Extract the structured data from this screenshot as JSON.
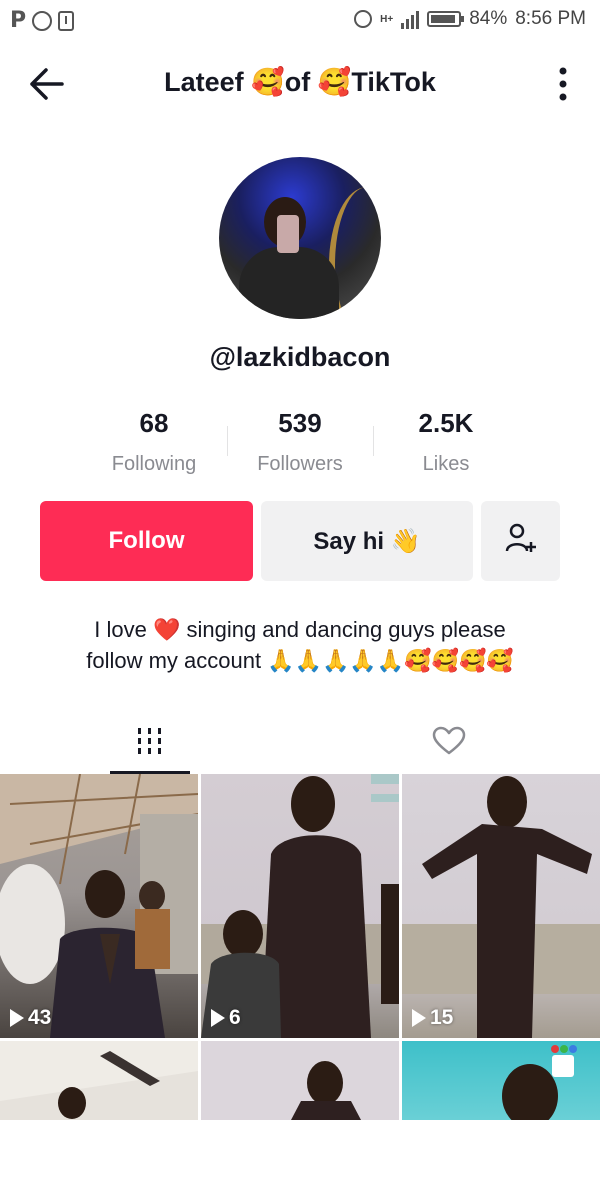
{
  "status_bar": {
    "left_icons": [
      "p-icon",
      "whatsapp-icon",
      "download-icon"
    ],
    "left_p": "P",
    "network": "H+",
    "battery": "84%",
    "time": "8:56 PM"
  },
  "header": {
    "title": "Lateef 🥰of 🥰TikTok",
    "back_icon": "back-arrow-icon",
    "more_icon": "more-vertical-icon"
  },
  "profile": {
    "handle": "@lazkidbacon",
    "stats": [
      {
        "value": "68",
        "label": "Following"
      },
      {
        "value": "539",
        "label": "Followers"
      },
      {
        "value": "2.5K",
        "label": "Likes"
      }
    ],
    "follow_label": "Follow",
    "say_hi_label": "Say hi 👋",
    "bio_line1": "I love ❤️ singing and dancing guys please",
    "bio_line2": "follow my account 🙏🙏🙏🙏🙏🥰🥰🥰🥰"
  },
  "tabs": [
    {
      "icon": "grid-icon",
      "active": true
    },
    {
      "icon": "heart-icon",
      "active": false
    }
  ],
  "videos": [
    {
      "views": "43"
    },
    {
      "views": "6"
    },
    {
      "views": "15"
    },
    {
      "views": ""
    },
    {
      "views": ""
    },
    {
      "views": ""
    }
  ],
  "colors": {
    "accent": "#fe2c55",
    "button_bg": "#f1f1f2",
    "text": "#161823",
    "muted": "#8a8b91"
  }
}
